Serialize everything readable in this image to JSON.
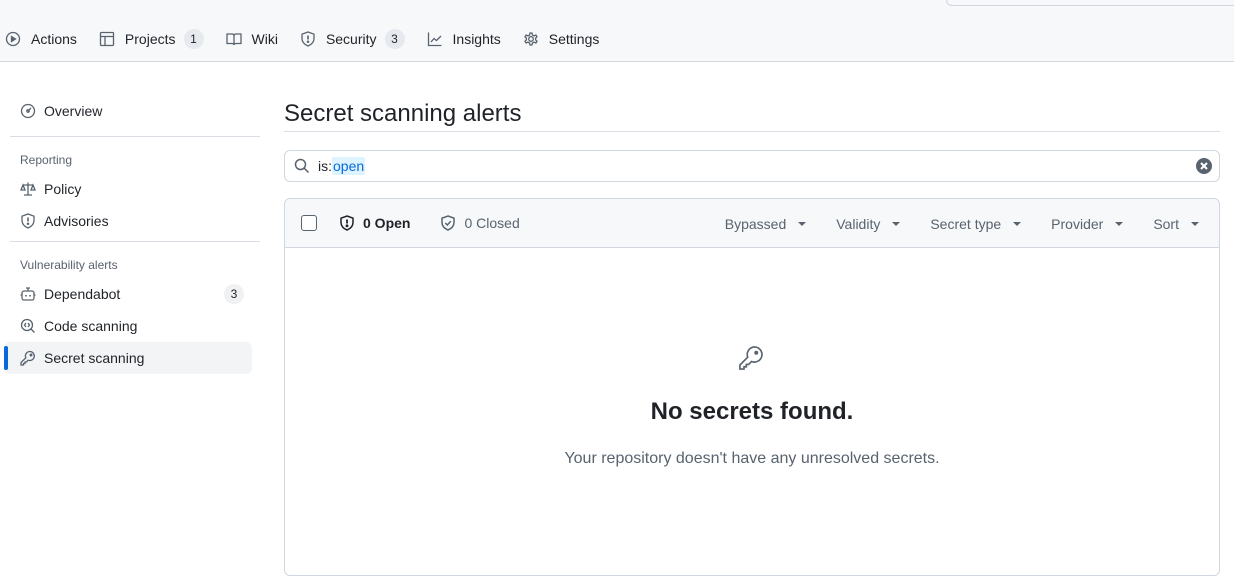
{
  "repo_nav": {
    "tabs": [
      {
        "label": "Actions",
        "icon": "play-icon"
      },
      {
        "label": "Projects",
        "icon": "table-icon",
        "counter": "1"
      },
      {
        "label": "Wiki",
        "icon": "book-icon"
      },
      {
        "label": "Security",
        "icon": "shield-icon",
        "counter": "3"
      },
      {
        "label": "Insights",
        "icon": "graph-icon"
      },
      {
        "label": "Settings",
        "icon": "gear-icon"
      }
    ]
  },
  "sidebar": {
    "overview": {
      "label": "Overview",
      "icon": "meter-icon"
    },
    "reporting_heading": "Reporting",
    "reporting": [
      {
        "label": "Policy",
        "icon": "law-icon"
      },
      {
        "label": "Advisories",
        "icon": "shield-icon"
      }
    ],
    "vuln_heading": "Vulnerability alerts",
    "vuln": [
      {
        "label": "Dependabot",
        "icon": "dependabot-icon",
        "counter": "3"
      },
      {
        "label": "Code scanning",
        "icon": "codescan-icon"
      },
      {
        "label": "Secret scanning",
        "icon": "key-icon",
        "active": true
      }
    ]
  },
  "main": {
    "title": "Secret scanning alerts",
    "search": {
      "key": "is:",
      "value": "open"
    },
    "header": {
      "open_label": "0 Open",
      "closed_label": "0 Closed",
      "filters": [
        "Bypassed",
        "Validity",
        "Secret type",
        "Provider",
        "Sort"
      ]
    },
    "blankslate": {
      "title": "No secrets found.",
      "description": "Your repository doesn't have any unresolved secrets."
    }
  },
  "colors": {
    "accent": "#0969da",
    "muted": "#59636e",
    "border": "#d0d7de",
    "canvas_subtle": "#f6f8fa"
  }
}
